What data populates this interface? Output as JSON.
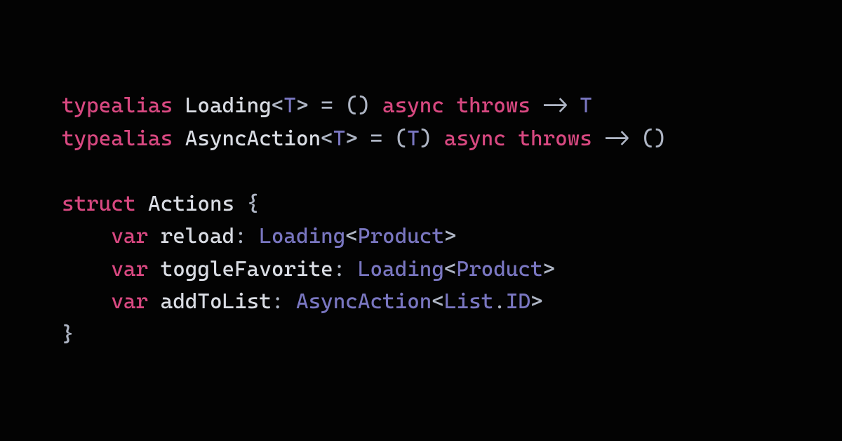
{
  "colors": {
    "background": "#030303",
    "keyword": "#d74880",
    "identifier": "#d9dce3",
    "type": "#7976c0",
    "punctuation": "#aeb5c4"
  },
  "code": {
    "lines": [
      [
        {
          "t": "typealias",
          "c": "kw"
        },
        {
          "t": " ",
          "c": "id"
        },
        {
          "t": "Loading",
          "c": "id"
        },
        {
          "t": "<",
          "c": "punc"
        },
        {
          "t": "T",
          "c": "type"
        },
        {
          "t": ">",
          "c": "punc"
        },
        {
          "t": " ",
          "c": "id"
        },
        {
          "t": "=",
          "c": "op"
        },
        {
          "t": " () ",
          "c": "punc"
        },
        {
          "t": "async",
          "c": "kw"
        },
        {
          "t": " ",
          "c": "id"
        },
        {
          "t": "throws",
          "c": "kw"
        },
        {
          "t": " ",
          "c": "id"
        },
        {
          "t": "->",
          "c": "op"
        },
        {
          "t": " ",
          "c": "id"
        },
        {
          "t": "T",
          "c": "type"
        }
      ],
      [
        {
          "t": "typealias",
          "c": "kw"
        },
        {
          "t": " ",
          "c": "id"
        },
        {
          "t": "AsyncAction",
          "c": "id"
        },
        {
          "t": "<",
          "c": "punc"
        },
        {
          "t": "T",
          "c": "type"
        },
        {
          "t": ">",
          "c": "punc"
        },
        {
          "t": " ",
          "c": "id"
        },
        {
          "t": "=",
          "c": "op"
        },
        {
          "t": " (",
          "c": "punc"
        },
        {
          "t": "T",
          "c": "type"
        },
        {
          "t": ") ",
          "c": "punc"
        },
        {
          "t": "async",
          "c": "kw"
        },
        {
          "t": " ",
          "c": "id"
        },
        {
          "t": "throws",
          "c": "kw"
        },
        {
          "t": " ",
          "c": "id"
        },
        {
          "t": "->",
          "c": "op"
        },
        {
          "t": " ()",
          "c": "punc"
        }
      ],
      [
        {
          "t": "",
          "c": "id"
        }
      ],
      [
        {
          "t": "struct",
          "c": "kw"
        },
        {
          "t": " ",
          "c": "id"
        },
        {
          "t": "Actions",
          "c": "id"
        },
        {
          "t": " {",
          "c": "punc"
        }
      ],
      [
        {
          "t": "    ",
          "c": "id"
        },
        {
          "t": "var",
          "c": "kw"
        },
        {
          "t": " ",
          "c": "id"
        },
        {
          "t": "reload",
          "c": "id"
        },
        {
          "t": ": ",
          "c": "punc"
        },
        {
          "t": "Loading",
          "c": "type"
        },
        {
          "t": "<",
          "c": "punc"
        },
        {
          "t": "Product",
          "c": "type"
        },
        {
          "t": ">",
          "c": "punc"
        }
      ],
      [
        {
          "t": "    ",
          "c": "id"
        },
        {
          "t": "var",
          "c": "kw"
        },
        {
          "t": " ",
          "c": "id"
        },
        {
          "t": "toggleFavorite",
          "c": "id"
        },
        {
          "t": ": ",
          "c": "punc"
        },
        {
          "t": "Loading",
          "c": "type"
        },
        {
          "t": "<",
          "c": "punc"
        },
        {
          "t": "Product",
          "c": "type"
        },
        {
          "t": ">",
          "c": "punc"
        }
      ],
      [
        {
          "t": "    ",
          "c": "id"
        },
        {
          "t": "var",
          "c": "kw"
        },
        {
          "t": " ",
          "c": "id"
        },
        {
          "t": "addToList",
          "c": "id"
        },
        {
          "t": ": ",
          "c": "punc"
        },
        {
          "t": "AsyncAction",
          "c": "type"
        },
        {
          "t": "<",
          "c": "punc"
        },
        {
          "t": "List",
          "c": "type"
        },
        {
          "t": ".",
          "c": "punc"
        },
        {
          "t": "ID",
          "c": "type"
        },
        {
          "t": ">",
          "c": "punc"
        }
      ],
      [
        {
          "t": "}",
          "c": "punc"
        }
      ]
    ]
  }
}
